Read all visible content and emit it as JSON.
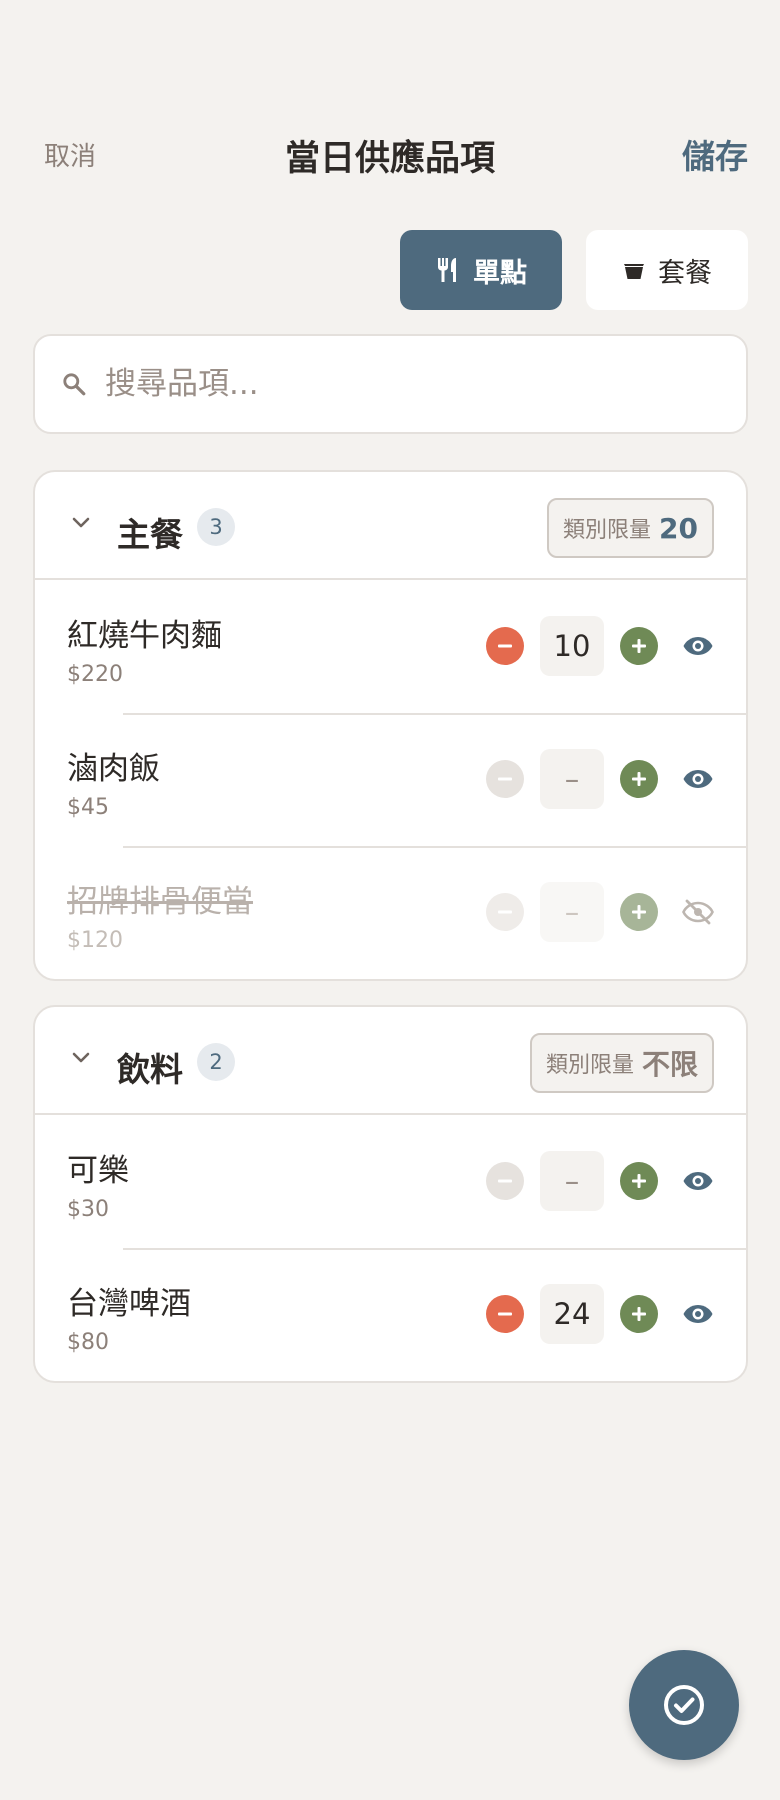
{
  "header": {
    "cancel_label": "取消",
    "title": "當日供應品項",
    "save_label": "儲存"
  },
  "mode_toggle": {
    "single_label": "單點",
    "set_label": "套餐",
    "active": "single"
  },
  "search": {
    "placeholder": "搜尋品項...",
    "value": ""
  },
  "categories": [
    {
      "name": "主餐",
      "count": "3",
      "limit_label": "類別限量",
      "limit_value": "20",
      "items": [
        {
          "name": "紅燒牛肉麵",
          "price": "$220",
          "qty": "10",
          "visible": true,
          "available": true
        },
        {
          "name": "滷肉飯",
          "price": "$45",
          "qty": "–",
          "visible": true,
          "available": true
        },
        {
          "name": "招牌排骨便當",
          "price": "$120",
          "qty": "–",
          "visible": false,
          "available": false
        }
      ]
    },
    {
      "name": "飲料",
      "count": "2",
      "limit_label": "類別限量",
      "limit_value": "不限",
      "items": [
        {
          "name": "可樂",
          "price": "$30",
          "qty": "–",
          "visible": true,
          "available": true
        },
        {
          "name": "台灣啤酒",
          "price": "$80",
          "qty": "24",
          "visible": true,
          "available": true
        }
      ]
    }
  ],
  "colors": {
    "primary": "#4E6A7E",
    "minus": "#E46A4E",
    "plus": "#6F8A56",
    "background": "#F4F2EF"
  },
  "icons": {
    "single_mode": "fork-knife-icon",
    "set_mode": "bowl-icon",
    "search": "search-icon",
    "collapse": "chevron-down-icon",
    "visible": "eye-icon",
    "hidden": "eye-off-icon",
    "confirm": "check-circle-icon"
  }
}
